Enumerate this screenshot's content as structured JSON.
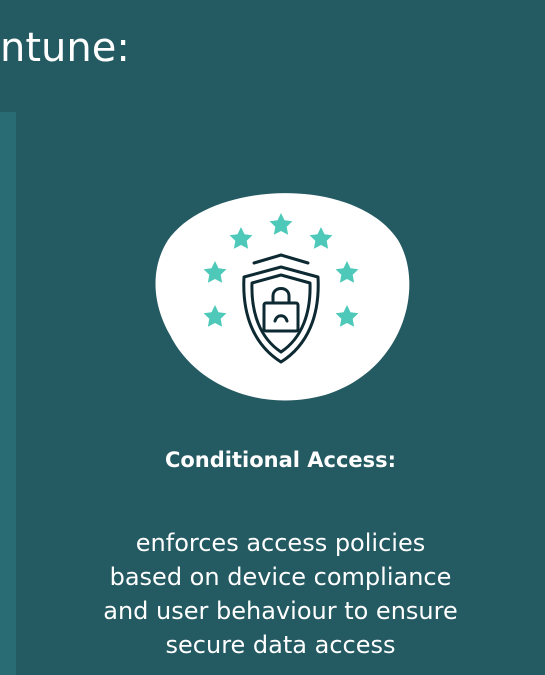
{
  "heading": "ntune:",
  "card": {
    "icon": "shield-lock-stars-icon",
    "title": "Conditional Access:",
    "description_lines": [
      "enforces access policies",
      "based on device compliance",
      "and user behaviour to ensure",
      "secure data access"
    ]
  },
  "colors": {
    "background": "#245a62",
    "panel": "#2a6c74",
    "star": "#4ec9b9",
    "icon_stroke": "#0d2a33",
    "text": "#ffffff"
  }
}
